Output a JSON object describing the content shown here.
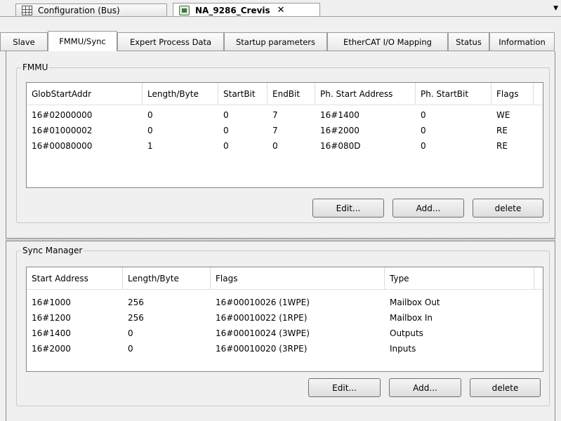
{
  "doc_tabs": [
    {
      "label": "Configuration (Bus)",
      "icon": "grid-icon",
      "active": false
    },
    {
      "label": "NA_9286_Crevis",
      "icon": "device-icon",
      "active": true,
      "close": "✕"
    }
  ],
  "tab_overflow_arrow": "▼",
  "sub_tabs": [
    {
      "label": "Slave"
    },
    {
      "label": "FMMU/Sync"
    },
    {
      "label": "Expert Process Data"
    },
    {
      "label": "Startup parameters"
    },
    {
      "label": "EtherCAT I/O Mapping"
    },
    {
      "label": "Status"
    },
    {
      "label": "Information"
    }
  ],
  "active_sub_tab": "FMMU/Sync",
  "fmmu": {
    "title": "FMMU",
    "columns": [
      "GlobStartAddr",
      "Length/Byte",
      "StartBit",
      "EndBit",
      "Ph. Start Address",
      "Ph. StartBit",
      "Flags"
    ],
    "rows": [
      [
        "16#02000000",
        "0",
        "0",
        "7",
        "16#1400",
        "0",
        "WE"
      ],
      [
        "16#01000002",
        "0",
        "0",
        "7",
        "16#2000",
        "0",
        "RE"
      ],
      [
        "16#00080000",
        "1",
        "0",
        "0",
        "16#080D",
        "0",
        "RE"
      ]
    ],
    "buttons": {
      "edit": "Edit...",
      "add": "Add...",
      "delete": "delete"
    }
  },
  "sync_manager": {
    "title": "Sync Manager",
    "columns": [
      "Start Address",
      "Length/Byte",
      "Flags",
      "Type"
    ],
    "rows": [
      [
        "16#1000",
        "256",
        "16#00010026 (1WPE)",
        "Mailbox Out"
      ],
      [
        "16#1200",
        "256",
        "16#00010022 (1RPE)",
        "Mailbox In"
      ],
      [
        "16#1400",
        "0",
        "16#00010024 (3WPE)",
        "Outputs"
      ],
      [
        "16#2000",
        "0",
        "16#00010020 (3RPE)",
        "Inputs"
      ]
    ],
    "buttons": {
      "edit": "Edit...",
      "add": "Add...",
      "delete": "delete"
    }
  }
}
